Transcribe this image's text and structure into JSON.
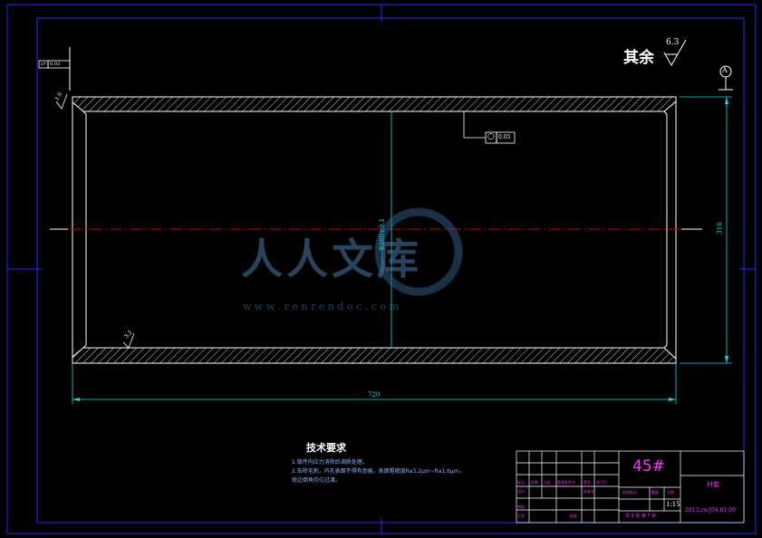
{
  "surface_roughness": {
    "label": "其余",
    "value": "6.3"
  },
  "datum": {
    "label": "A"
  },
  "flatness_frame": {
    "symbol": "⏥",
    "value": "0.03"
  },
  "roundness_frame": {
    "symbol": "○",
    "value": "0.05"
  },
  "roughness_inner": "3.2",
  "roughness_chamfer": "1.6",
  "dimensions": {
    "length": "720",
    "outer_diameter": "316",
    "inner_diameter": "Φ280±0.1"
  },
  "tech_requirements": {
    "title": "技术要求",
    "items": [
      "1.锻件内应力消除后调质处理。",
      "2.去除毛刺，内孔表面不得有划痕，表面粗糙度Ra3.2μm~Ra1.6μm。",
      "  锐边倒角均匀过渡。"
    ]
  },
  "title_block": {
    "material": "45#",
    "part_name": "衬套",
    "drawing_no": "2013.zw.J04.01.09",
    "scale": "1:15",
    "sheet": "共 9 张 第 7 张",
    "labels": [
      "标记",
      "处数",
      "分区",
      "更改文件号",
      "签名",
      "年月日",
      "设计",
      "标准化",
      "审核",
      "工艺",
      "批准",
      "阶段标记",
      "重量",
      "比例"
    ]
  },
  "watermark": {
    "brand": "人人文库",
    "url": "w w w . r e n r e n d o c . c o m"
  },
  "colors": {
    "outline": "#ffffff",
    "dimension": "#00e5e5",
    "centerline": "#d00000",
    "frame": "#2020ff",
    "accent": "#ff00ff"
  }
}
